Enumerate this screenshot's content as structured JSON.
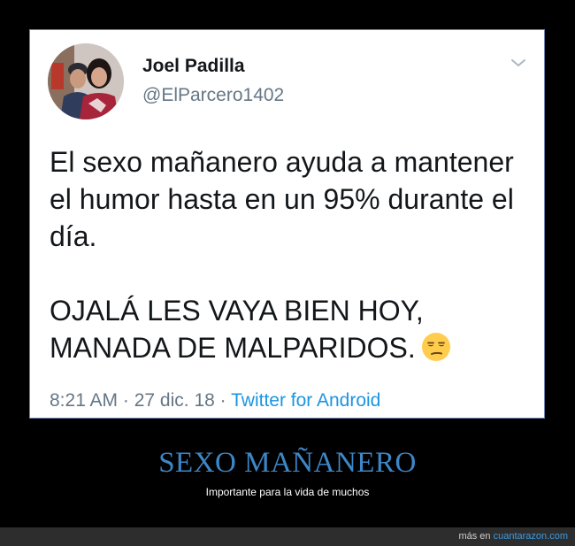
{
  "tweet": {
    "author_name": "Joel Padilla",
    "author_handle": "@ElParcero1402",
    "text_paragraph_1": "El sexo mañanero ayuda a mantener el humor hasta en un 95% durante el día.",
    "text_paragraph_2": "OJALÁ LES VAYA BIEN HOY, MANADA DE MALPARIDOS.",
    "emoji": "unamused-face-emoji",
    "time": "8:21 AM",
    "separator": " · ",
    "date": "27 dic. 18",
    "source": "Twitter for Android",
    "menu_icon": "chevron-down-icon"
  },
  "caption": {
    "title": "SEXO MAÑANERO",
    "subtitle": "Importante para la vida de muchos"
  },
  "footer": {
    "prefix": "más en ",
    "site": "cuantarazon.com"
  },
  "colors": {
    "background": "#000000",
    "card": "#ffffff",
    "card_border": "#6c86b0",
    "title_blue": "#3d87c8",
    "link_blue": "#1b95e0",
    "muted_text": "#657786"
  }
}
